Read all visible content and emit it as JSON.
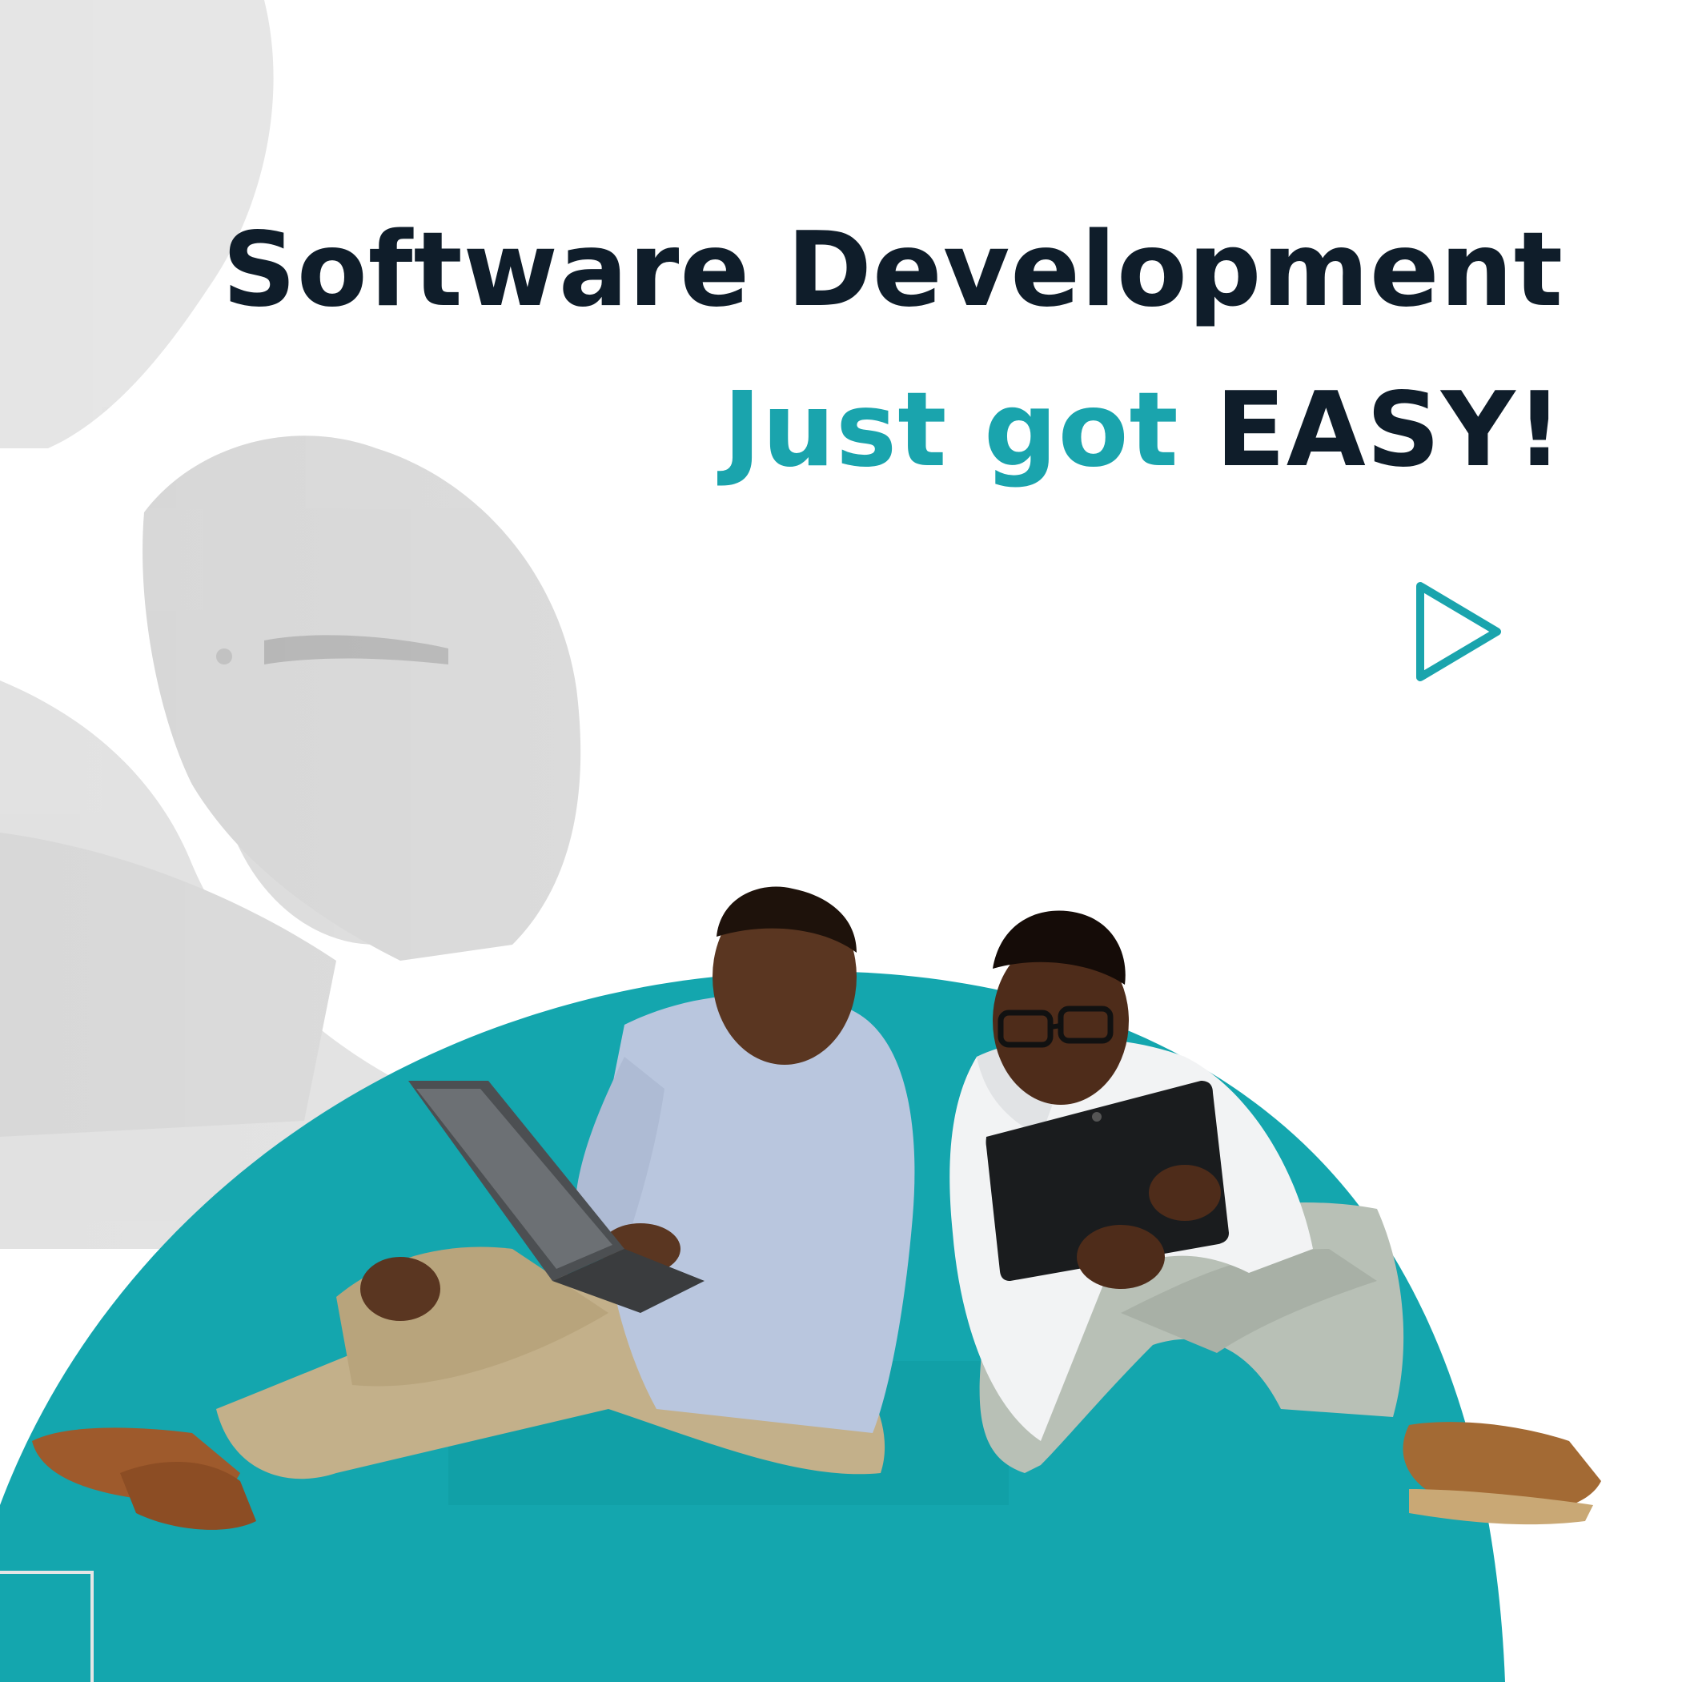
{
  "headline": {
    "line1": "Software Development",
    "line2_accent": "Just got",
    "line2_strong": "EASY!"
  },
  "colors": {
    "heading_dark": "#0f1d2a",
    "accent_teal": "#1aa4ad",
    "dome_teal": "#14a6ae",
    "background": "#ffffff",
    "faded_photo": "#d9d9d9"
  },
  "icons": {
    "play": "play-triangle-outline-icon",
    "corner": "corner-frame-icon"
  }
}
